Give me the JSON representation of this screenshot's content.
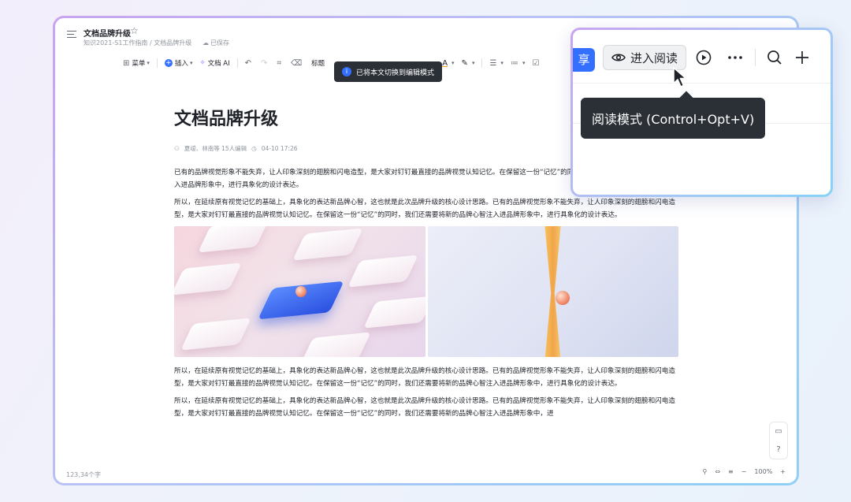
{
  "document": {
    "title": "文档品牌升级",
    "breadcrumb": "知识2021-S1工作指南 / 文档品牌升级",
    "saved_status": "已保存",
    "meta_authors": "夏叆、林南等 15人编辑",
    "meta_time": "04-10 17:26",
    "paragraphs": [
      "已有的品牌视觉形象不能失弃，让人印象深刻的翅膀和闪电造型，是大家对钉钉最直接的品牌视觉认知记忆。在保留这一份“记忆”的同时，我们还需要将新的品牌心智注入进品牌形象中，进行具象化的设计表达。",
      "所以，在延续原有视觉记忆的基础上，具象化的表达新品牌心智，这也就是此次品牌升级的核心设计思路。已有的品牌视觉形象不能失弃，让人印象深刻的翅膀和闪电造型，是大家对钉钉最直接的品牌视觉认知记忆。在保留这一份“记忆”的同时，我们还需要将新的品牌心智注入进品牌形象中，进行具象化的设计表达。",
      "所以，在延续原有视觉记忆的基础上，具象化的表达新品牌心智，这也就是此次品牌升级的核心设计思路。已有的品牌视觉形象不能失弃，让人印象深刻的翅膀和闪电造型，是大家对钉钉最直接的品牌视觉认知记忆。在保留这一份“记忆”的同时，我们还需要将新的品牌心智注入进品牌形象中，进行具象化的设计表达。",
      "所以，在延续原有视觉记忆的基础上，具象化的表达新品牌心智，这也就是此次品牌升级的核心设计思路。已有的品牌视觉形象不能失弃，让人印象深刻的翅膀和闪电造型，是大家对钉钉最直接的品牌视觉认知记忆。在保留这一份“记忆”的同时，我们还需要将新的品牌心智注入进品牌形象中，进"
    ]
  },
  "toolbar": {
    "menu_label": "菜单",
    "insert_label": "插入",
    "ai_label": "文档 AI",
    "heading_label": "标题"
  },
  "toast": {
    "text": "已将本文切换到编辑模式"
  },
  "status": {
    "word_count": "123,34个字",
    "zoom": "100%"
  },
  "popup": {
    "share_label": "享",
    "read_button_label": "进入阅读",
    "tooltip": "阅读模式 (Control+Opt+V)"
  },
  "colors": {
    "accent": "#3370ff",
    "tooltip_bg": "#2b2f36"
  }
}
